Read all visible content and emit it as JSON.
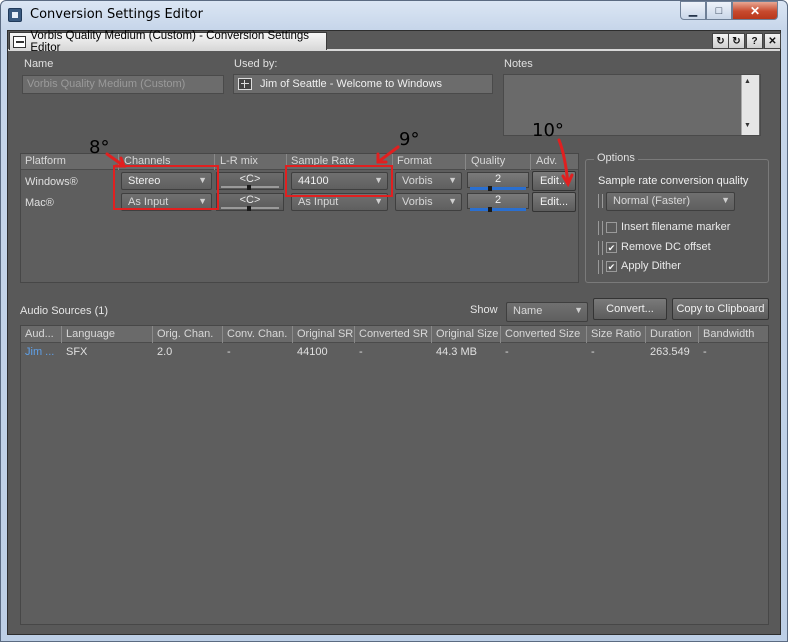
{
  "window": {
    "title": "Conversion Settings Editor",
    "min": "▁",
    "max": "□",
    "close": "✕"
  },
  "doc_tab": {
    "title": "Vorbis Quality Medium (Custom) - Conversion Settings Editor",
    "btn1": "↻",
    "btn2": "↻",
    "btn3": "?",
    "btn4": "✕"
  },
  "fields": {
    "name_label": "Name",
    "name_value": "Vorbis Quality Medium (Custom)",
    "usedby_label": "Used by:",
    "usedby_value": "Jim of Seattle - Welcome to Windows",
    "notes_label": "Notes"
  },
  "platform_grid": {
    "columns": [
      "Platform",
      "Channels",
      "L-R mix",
      "Sample Rate",
      "Format",
      "Quality",
      "Adv."
    ],
    "rows": [
      {
        "platform": "Windows®",
        "channels": "Stereo",
        "lr_mix": "<C>",
        "sample_rate": "44100",
        "format": "Vorbis",
        "quality": "2",
        "adv": "Edit..."
      },
      {
        "platform": "Mac®",
        "channels": "As Input",
        "lr_mix": "<C>",
        "sample_rate": "As Input",
        "format": "Vorbis",
        "quality": "2",
        "adv": "Edit..."
      }
    ]
  },
  "options": {
    "title": "Options",
    "src_quality_label": "Sample rate conversion quality",
    "src_quality_value": "Normal (Faster)",
    "checkboxes": [
      {
        "label": "Insert filename marker",
        "checked": false
      },
      {
        "label": "Remove DC offset",
        "checked": true
      },
      {
        "label": "Apply Dither",
        "checked": true
      }
    ]
  },
  "sources": {
    "title": "Audio Sources (1)",
    "show_label": "Show",
    "show_value": "Name",
    "convert_button": "Convert...",
    "clipboard_button": "Copy to Clipboard",
    "columns": [
      "Aud...",
      "Language",
      "Orig. Chan.",
      "Conv. Chan.",
      "Original SR",
      "Converted SR",
      "Original Size",
      "Converted Size",
      "Size Ratio",
      "Duration",
      "Bandwidth"
    ],
    "rows": [
      [
        "Jim ...",
        "SFX",
        "2.0",
        "-",
        "44100",
        "-",
        "44.3 MB",
        "-",
        "-",
        "263.549",
        "-"
      ]
    ]
  },
  "annotations": {
    "a8": "8°",
    "a9": "9°",
    "a10": "10°",
    "color": "#e02020"
  },
  "glyphs": {
    "arrow": "▼",
    "check": "✔",
    "up": "▲",
    "down": "▼"
  }
}
